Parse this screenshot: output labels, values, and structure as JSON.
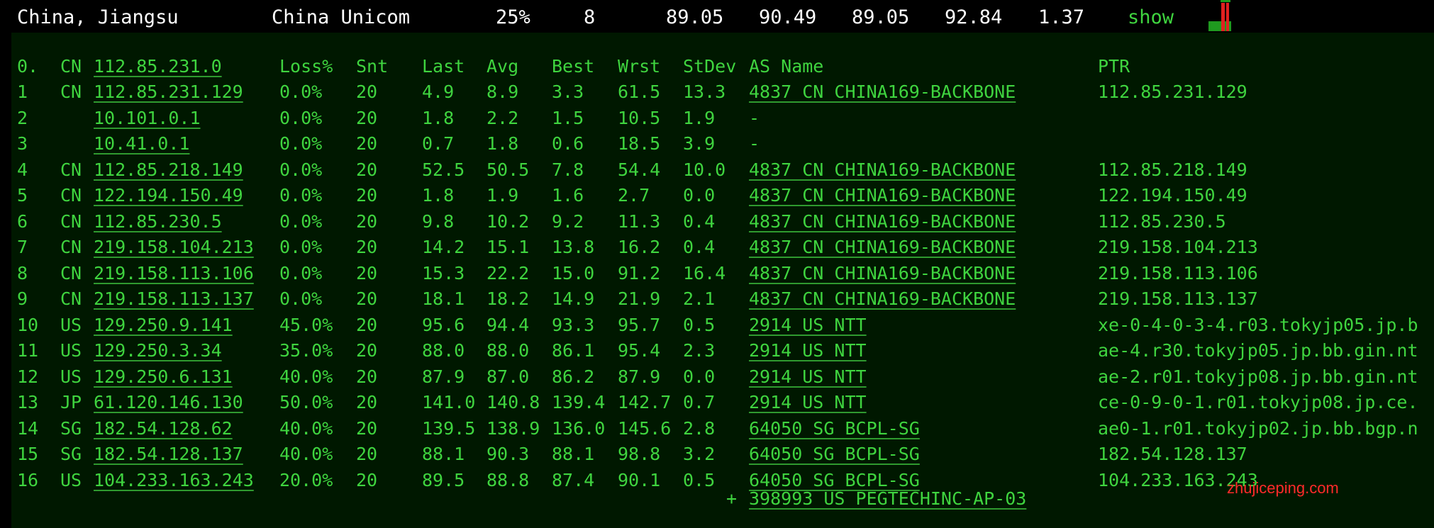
{
  "summary": {
    "location": "China, Jiangsu",
    "isp": "China Unicom",
    "loss": "25%",
    "sent": "8",
    "last": "89.05",
    "avg": "90.49",
    "best": "89.05",
    "worst": "92.84",
    "stdev": "1.37",
    "show_label": "show"
  },
  "table": {
    "header": {
      "idx": "0.",
      "cc": "CN",
      "host": "112.85.231.0",
      "loss": "Loss%",
      "snt": "Snt",
      "last": "Last",
      "avg": "Avg",
      "best": "Best",
      "wrst": "Wrst",
      "stdev": "StDev",
      "as_name": "AS Name",
      "ptr": "PTR"
    },
    "rows": [
      {
        "idx": "1",
        "cc": "CN",
        "host": "112.85.231.129",
        "loss": "0.0%",
        "snt": "20",
        "last": "4.9",
        "avg": "8.9",
        "best": "3.3",
        "wrst": "61.5",
        "stdev": "13.3",
        "as": "4837  CN CHINA169-BACKBONE",
        "ptr": "112.85.231.129"
      },
      {
        "idx": "2",
        "cc": "",
        "host": "10.101.0.1",
        "loss": "0.0%",
        "snt": "20",
        "last": "1.8",
        "avg": "2.2",
        "best": "1.5",
        "wrst": "10.5",
        "stdev": "1.9",
        "as": "-",
        "ptr": ""
      },
      {
        "idx": "3",
        "cc": "",
        "host": "10.41.0.1",
        "loss": "0.0%",
        "snt": "20",
        "last": "0.7",
        "avg": "1.8",
        "best": "0.6",
        "wrst": "18.5",
        "stdev": "3.9",
        "as": "-",
        "ptr": ""
      },
      {
        "idx": "4",
        "cc": "CN",
        "host": "112.85.218.149",
        "loss": "0.0%",
        "snt": "20",
        "last": "52.5",
        "avg": "50.5",
        "best": "7.8",
        "wrst": "54.4",
        "stdev": "10.0",
        "as": "4837  CN CHINA169-BACKBONE",
        "ptr": "112.85.218.149"
      },
      {
        "idx": "5",
        "cc": "CN",
        "host": "122.194.150.49",
        "loss": "0.0%",
        "snt": "20",
        "last": "1.8",
        "avg": "1.9",
        "best": "1.6",
        "wrst": "2.7",
        "stdev": "0.0",
        "as": "4837  CN CHINA169-BACKBONE",
        "ptr": "122.194.150.49"
      },
      {
        "idx": "6",
        "cc": "CN",
        "host": "112.85.230.5",
        "loss": "0.0%",
        "snt": "20",
        "last": "9.8",
        "avg": "10.2",
        "best": "9.2",
        "wrst": "11.3",
        "stdev": "0.4",
        "as": "4837  CN CHINA169-BACKBONE",
        "ptr": "112.85.230.5"
      },
      {
        "idx": "7",
        "cc": "CN",
        "host": "219.158.104.213",
        "loss": "0.0%",
        "snt": "20",
        "last": "14.2",
        "avg": "15.1",
        "best": "13.8",
        "wrst": "16.2",
        "stdev": "0.4",
        "as": "4837  CN CHINA169-BACKBONE",
        "ptr": "219.158.104.213"
      },
      {
        "idx": "8",
        "cc": "CN",
        "host": "219.158.113.106",
        "loss": "0.0%",
        "snt": "20",
        "last": "15.3",
        "avg": "22.2",
        "best": "15.0",
        "wrst": "91.2",
        "stdev": "16.4",
        "as": "4837  CN CHINA169-BACKBONE",
        "ptr": "219.158.113.106"
      },
      {
        "idx": "9",
        "cc": "CN",
        "host": "219.158.113.137",
        "loss": "0.0%",
        "snt": "20",
        "last": "18.1",
        "avg": "18.2",
        "best": "14.9",
        "wrst": "21.9",
        "stdev": "2.1",
        "as": "4837  CN CHINA169-BACKBONE",
        "ptr": "219.158.113.137"
      },
      {
        "idx": "10",
        "cc": "US",
        "host": "129.250.9.141",
        "loss": "45.0%",
        "snt": "20",
        "last": "95.6",
        "avg": "94.4",
        "best": "93.3",
        "wrst": "95.7",
        "stdev": "0.5",
        "as": "2914  US NTT",
        "ptr": "xe-0-4-0-3-4.r03.tokyjp05.jp.b"
      },
      {
        "idx": "11",
        "cc": "US",
        "host": "129.250.3.34",
        "loss": "35.0%",
        "snt": "20",
        "last": "88.0",
        "avg": "88.0",
        "best": "86.1",
        "wrst": "95.4",
        "stdev": "2.3",
        "as": "2914  US NTT",
        "ptr": "ae-4.r30.tokyjp05.jp.bb.gin.nt"
      },
      {
        "idx": "12",
        "cc": "US",
        "host": "129.250.6.131",
        "loss": "40.0%",
        "snt": "20",
        "last": "87.9",
        "avg": "87.0",
        "best": "86.2",
        "wrst": "87.9",
        "stdev": "0.0",
        "as": "2914  US NTT",
        "ptr": "ae-2.r01.tokyjp08.jp.bb.gin.nt"
      },
      {
        "idx": "13",
        "cc": "JP",
        "host": "61.120.146.130",
        "loss": "50.0%",
        "snt": "20",
        "last": "141.0",
        "avg": "140.8",
        "best": "139.4",
        "wrst": "142.7",
        "stdev": "0.7",
        "as": "2914  US NTT",
        "ptr": "ce-0-9-0-1.r01.tokyjp08.jp.ce."
      },
      {
        "idx": "14",
        "cc": "SG",
        "host": "182.54.128.62",
        "loss": "40.0%",
        "snt": "20",
        "last": "139.5",
        "avg": "138.9",
        "best": "136.0",
        "wrst": "145.6",
        "stdev": "2.8",
        "as": "64050 SG BCPL-SG",
        "ptr": "ae0-1.r01.tokyjp02.jp.bb.bgp.n"
      },
      {
        "idx": "15",
        "cc": "SG",
        "host": "182.54.128.137",
        "loss": "40.0%",
        "snt": "20",
        "last": "88.1",
        "avg": "90.3",
        "best": "88.1",
        "wrst": "98.8",
        "stdev": "3.2",
        "as": "64050 SG BCPL-SG",
        "ptr": "182.54.128.137"
      },
      {
        "idx": "16",
        "cc": "US",
        "host": "104.233.163.243",
        "loss": "20.0%",
        "snt": "20",
        "last": "89.5",
        "avg": "88.8",
        "best": "87.4",
        "wrst": "90.1",
        "stdev": "0.5",
        "as": "64050 SG BCPL-SG",
        "ptr": "104.233.163.243"
      }
    ],
    "extra": {
      "prefix": "+",
      "as": "398993 US PEGTECHINC-AP-03"
    }
  },
  "watermark": "zhujiceping.com",
  "colors": {
    "text_green": "#3fd43f",
    "panel_bg": "#001800",
    "watermark_red": "#ff2a2a"
  }
}
